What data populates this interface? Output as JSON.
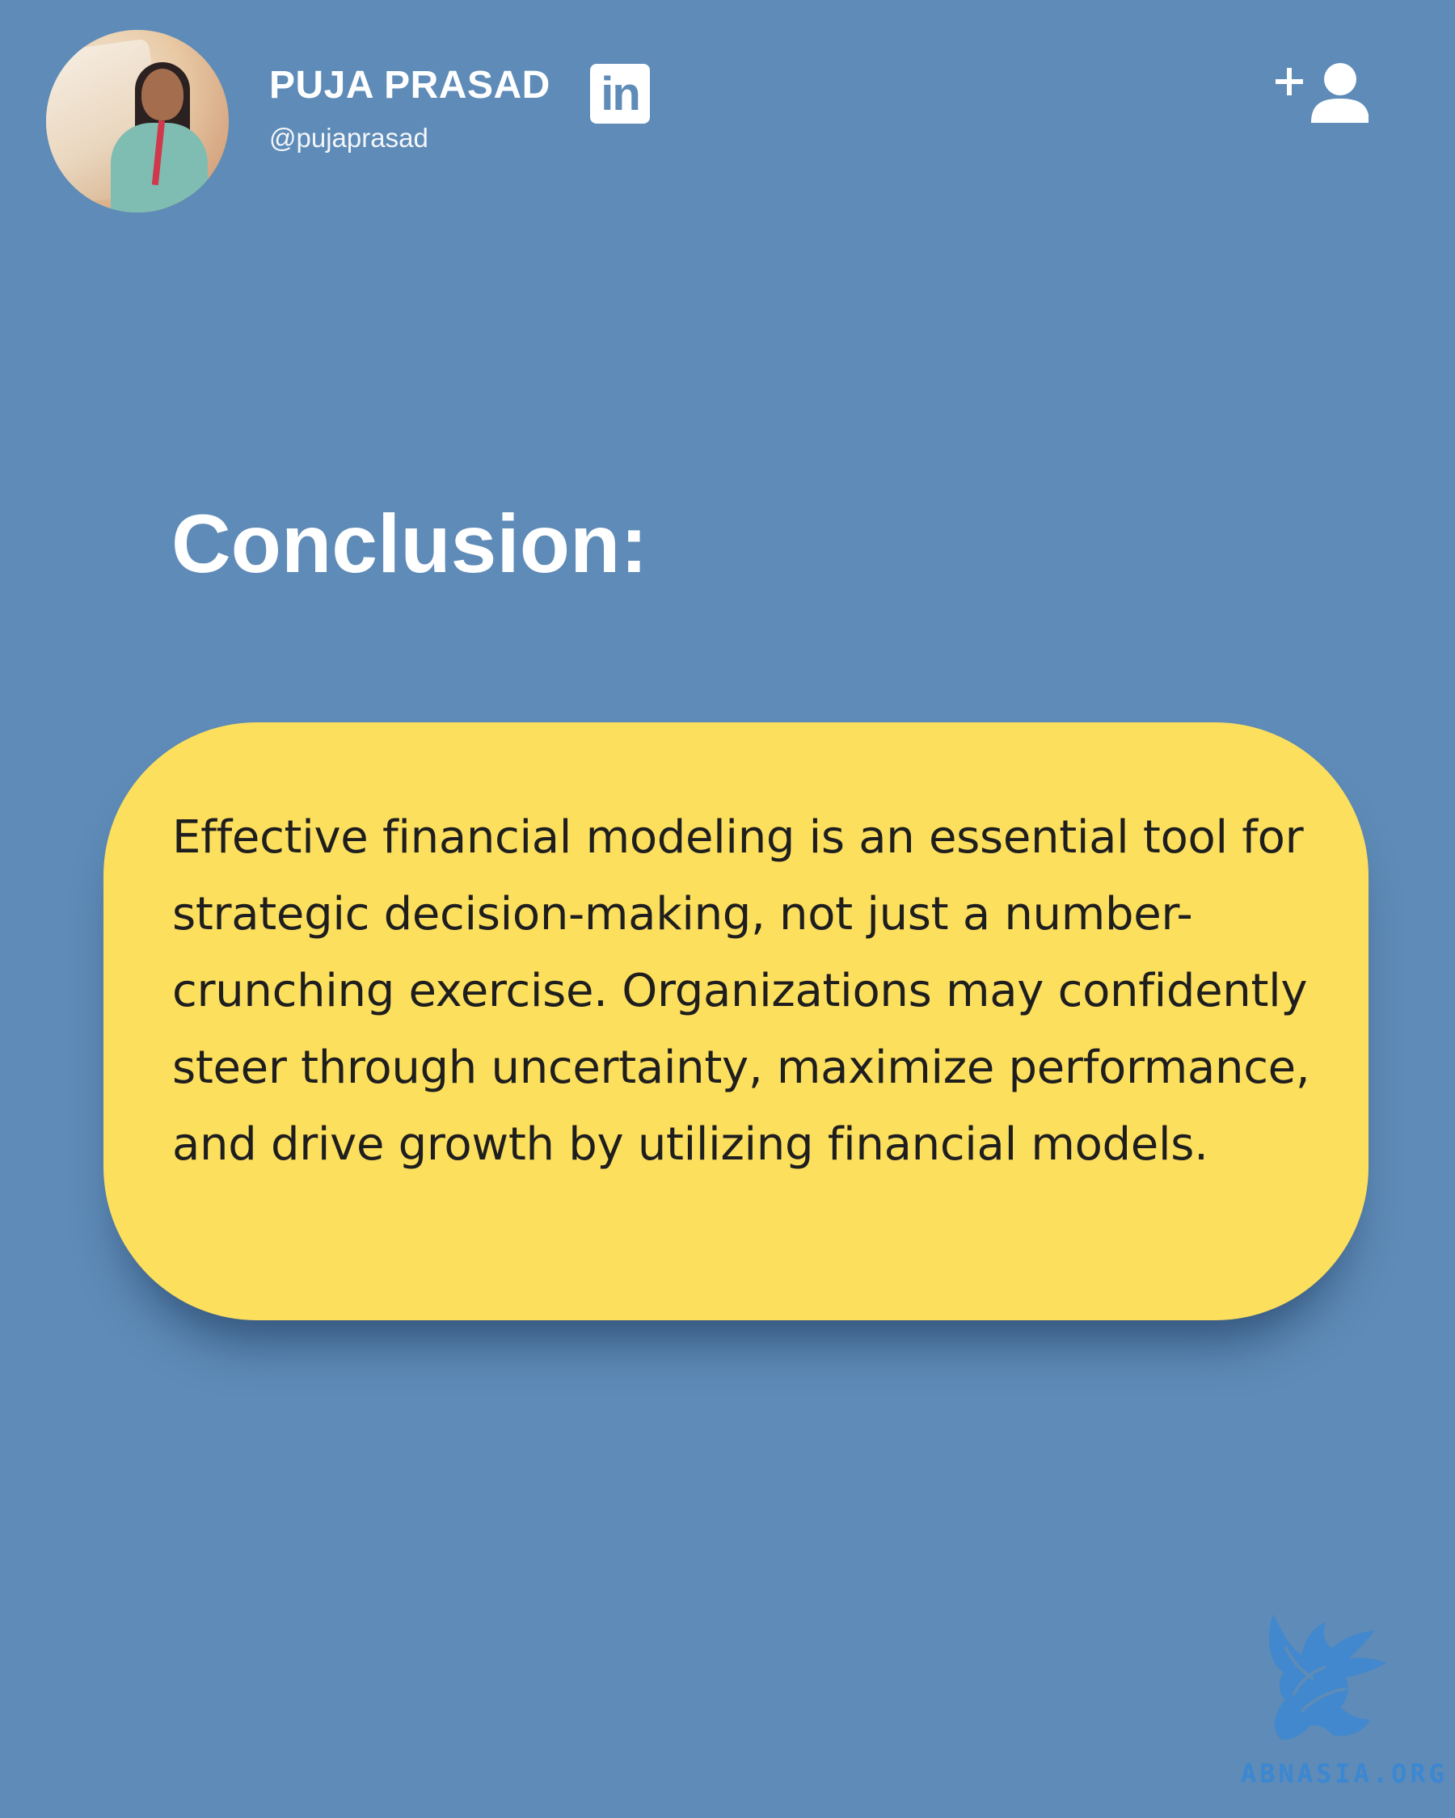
{
  "profile": {
    "name": "PUJA PRASAD",
    "handle": "@pujaprasad",
    "avatar_icon": "profile-photo",
    "linkedin_label": "in",
    "follow_icon": "add-user-icon"
  },
  "main": {
    "title": "Conclusion:",
    "body": "Effective financial modeling is an essential tool for strategic decision-making, not just a number-crunching exercise. Organizations may confidently steer through uncertainty, maximize performance, and drive growth by utilizing financial models."
  },
  "watermark": {
    "site": "ABNASIA.ORG",
    "icon": "griffin-logo-icon"
  },
  "colors": {
    "background": "#5e8bb7",
    "card": "#fddf5e",
    "text_dark": "#1e1e1e",
    "text_light": "#ffffff",
    "watermark": "#3c87d2"
  }
}
